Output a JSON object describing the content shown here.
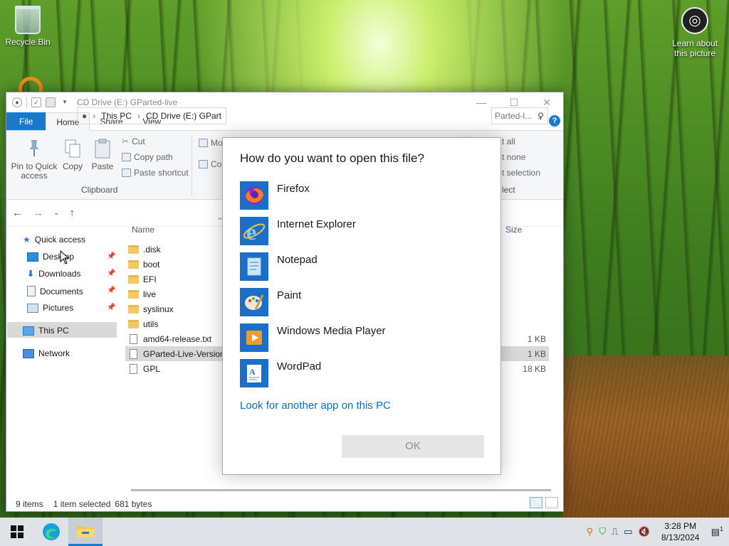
{
  "desktop": {
    "recycle_bin": "Recycle Bin",
    "learn": "Learn about this picture"
  },
  "explorer": {
    "title": "CD Drive (E:) GParted-live",
    "tabs": [
      "File",
      "Home",
      "Share",
      "View"
    ],
    "ribbon": {
      "pin": "Pin to Quick access",
      "copy": "Copy",
      "paste": "Paste",
      "cut": "Cut",
      "copy_path": "Copy path",
      "paste_shortcut": "Paste shortcut",
      "clipboard_label": "Clipboard",
      "move_partial": "Mo",
      "copy_to_partial": "Co",
      "select_all": "t all",
      "select_none": "t none",
      "invert": "t selection",
      "select_label": "lect"
    },
    "address": {
      "this_pc": "This PC",
      "drive": "CD Drive (E:) GPart",
      "search": "Parted-l..."
    },
    "nav": {
      "quick_access": "Quick access",
      "desktop": "Desktop",
      "downloads": "Downloads",
      "documents": "Documents",
      "pictures": "Pictures",
      "this_pc": "This PC",
      "network": "Network"
    },
    "columns": {
      "name": "Name",
      "size": "Size"
    },
    "files": [
      {
        "name": ".disk",
        "size": ""
      },
      {
        "name": "boot",
        "size": ""
      },
      {
        "name": "EFI",
        "size": ""
      },
      {
        "name": "live",
        "size": ""
      },
      {
        "name": "syslinux",
        "size": ""
      },
      {
        "name": "utils",
        "size": ""
      },
      {
        "name": "amd64-release.txt",
        "size": "1 KB"
      },
      {
        "name": "GParted-Live-Version",
        "size": "1 KB"
      },
      {
        "name": "GPL",
        "size": "18 KB"
      }
    ],
    "status": {
      "items": "9 items",
      "selected": "1 item selected",
      "bytes": "681 bytes"
    }
  },
  "dialog": {
    "title": "How do you want to open this file?",
    "apps": [
      "Firefox",
      "Internet Explorer",
      "Notepad",
      "Paint",
      "Windows Media Player",
      "WordPad"
    ],
    "look_link": "Look for another app on this PC",
    "ok": "OK"
  },
  "taskbar": {
    "time": "3:28 PM",
    "date": "8/13/2024",
    "notif_count": "1"
  }
}
